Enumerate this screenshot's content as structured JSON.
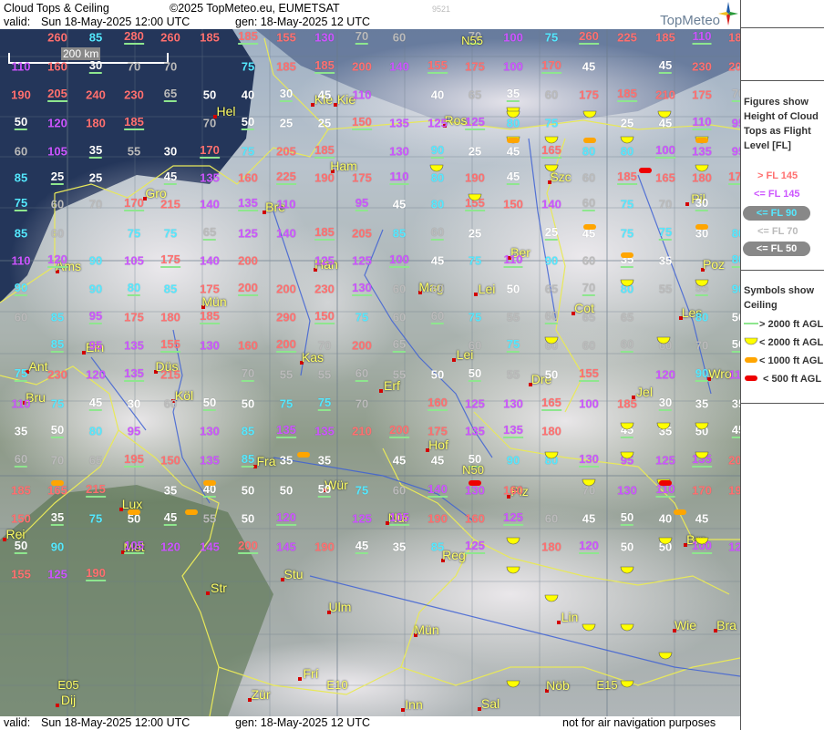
{
  "header": {
    "title": "Cloud Tops & Ceiling",
    "copyright": "©2025 TopMeteo.eu, EUMETSAT",
    "tiny_code": "9521",
    "valid_label": "valid:",
    "valid_value": "Sun  18-May-2025  12:00 UTC",
    "gen": "gen: 18-May-2025 12 UTC",
    "logo": "TopMeteo"
  },
  "footer": {
    "valid_label": "valid:",
    "valid_value": "Sun  18-May-2025  12:00 UTC",
    "gen": "gen: 18-May-2025 12 UTC",
    "disclaimer": "not for air navigation purposes"
  },
  "scale_bar": {
    "label": "200 km"
  },
  "legend": {
    "title": "Figures show Height of Cloud Tops as Flight Level  [FL]",
    "items": [
      {
        "label": "> FL 145",
        "color": "#ff7070"
      },
      {
        "label": "<= FL 145",
        "color": "#cc55ff"
      },
      {
        "label": "<= FL 90",
        "color": "#55e8ff"
      },
      {
        "label": "<= FL 70",
        "color": "#bbbbbb"
      },
      {
        "label": "<= FL 50",
        "color": "#ffffff"
      }
    ],
    "symbols_title": "Symbols show Ceiling",
    "symbols": [
      {
        "label": "> 2000 ft AGL",
        "icon": "green-line-icon"
      },
      {
        "label": "< 2000 ft AGL",
        "icon": "yellow-half-circle-icon"
      },
      {
        "label": "< 1000 ft AGL",
        "icon": "orange-oval-icon"
      },
      {
        "label": "< 500 ft AGL",
        "icon": "red-oval-icon"
      }
    ]
  },
  "colors": {
    "gt145": "#ff7070",
    "le145": "#cc55ff",
    "le90": "#55e8ff",
    "le70": "#bbbbbb",
    "le50": "#ffffff",
    "ceiling_high": "#8ee68e",
    "ceiling_2000": "#ffff00",
    "ceiling_1000": "#ffa500",
    "ceiling_500": "#ee0000"
  },
  "cities": [
    "Hel",
    "Kie",
    "Ham",
    "Ros",
    "Gro",
    "Bre",
    "Szc",
    "Pil",
    "Ams",
    "Han",
    "Ber",
    "Poz",
    "Mün",
    "Mag",
    "Lei",
    "Cot",
    "Les",
    "Ein",
    "Ant",
    "Düs",
    "Kas",
    "Erf",
    "Lei",
    "Dre",
    "Wro",
    "Bru",
    "Köl",
    "Jel",
    "Fra",
    "Hof",
    "Plz",
    "Brn",
    "Lux",
    "Wür",
    "Nür",
    "Rei",
    "Met",
    "Reg",
    "Str",
    "Stu",
    "Ulm",
    "Lin",
    "Wie",
    "Bra",
    "Mün",
    "Frí",
    "Zür",
    "Inn",
    "Sal",
    "Nöb",
    "Dij",
    "Kle"
  ],
  "grid_labels": [
    "N55",
    "N50",
    "E05",
    "E10",
    "E15"
  ],
  "cloud_top_values": [
    "260",
    "85",
    "280",
    "260",
    "185",
    "185",
    "155",
    "130",
    "70",
    "60",
    "70",
    "100",
    "75",
    "260",
    "225",
    "185",
    "110",
    "180",
    "110",
    "160",
    "30",
    "70",
    "70",
    "75",
    "185",
    "185",
    "200",
    "140",
    "155",
    "175",
    "100",
    "170",
    "45",
    "45",
    "230",
    "200",
    "190",
    "205",
    "240",
    "230",
    "65",
    "50",
    "40",
    "30",
    "45",
    "110",
    "40",
    "65",
    "35",
    "60",
    "175",
    "185",
    "210",
    "175",
    "70",
    "50",
    "120",
    "180",
    "185",
    "70",
    "50",
    "25",
    "25",
    "150",
    "135",
    "125",
    "125",
    "80",
    "75",
    "25",
    "45",
    "110",
    "95",
    "60",
    "105",
    "35",
    "55",
    "30",
    "170",
    "75",
    "205",
    "185",
    "130",
    "90",
    "25",
    "45",
    "165",
    "80",
    "80",
    "100",
    "135",
    "95",
    "85",
    "25",
    "25",
    "45",
    "135",
    "160",
    "225",
    "190",
    "175",
    "110",
    "80",
    "190",
    "45",
    "60",
    "185",
    "165",
    "180",
    "170",
    "75",
    "60",
    "70",
    "170",
    "215",
    "140",
    "135",
    "110",
    "95",
    "45",
    "80",
    "155",
    "150",
    "140",
    "60",
    "75",
    "70",
    "30",
    "85",
    "60",
    "75",
    "75",
    "65",
    "125",
    "140",
    "185",
    "205",
    "85",
    "60",
    "25",
    "25",
    "45",
    "75",
    "75",
    "30",
    "80",
    "110",
    "120",
    "90",
    "105",
    "175",
    "140",
    "200",
    "125",
    "125",
    "100",
    "45",
    "75",
    "110",
    "90",
    "60",
    "35",
    "35",
    "80",
    "90",
    "90",
    "80",
    "85",
    "175",
    "200",
    "200",
    "230",
    "130",
    "60",
    "60",
    "50",
    "65",
    "70",
    "80",
    "55",
    "55",
    "90",
    "60",
    "85",
    "95",
    "175",
    "180",
    "185",
    "290",
    "150",
    "75",
    "60",
    "60",
    "75",
    "55",
    "60",
    "65",
    "65",
    "80",
    "50",
    "85",
    "95",
    "135",
    "155",
    "130",
    "160",
    "200",
    "70",
    "200",
    "65",
    "60",
    "75",
    "60",
    "60",
    "60",
    "60",
    "70",
    "50",
    "75",
    "230",
    "120",
    "135",
    "215",
    "70",
    "55",
    "55",
    "60",
    "55",
    "50",
    "50",
    "55",
    "50",
    "155",
    "120",
    "90",
    "115",
    "110",
    "75",
    "45",
    "30",
    "60",
    "50",
    "50",
    "75",
    "75",
    "70",
    "160",
    "125",
    "130",
    "165",
    "100",
    "185",
    "30",
    "35",
    "35",
    "35",
    "50",
    "80",
    "95",
    "130",
    "85",
    "135",
    "135",
    "210",
    "200",
    "175",
    "135",
    "135",
    "180",
    "45",
    "35",
    "50",
    "45",
    "60",
    "70",
    "65",
    "195",
    "150",
    "135",
    "85",
    "35",
    "35",
    "45",
    "45",
    "50",
    "90",
    "80",
    "130",
    "95",
    "125",
    "135",
    "205",
    "185",
    "165",
    "215",
    "35",
    "40",
    "50",
    "50",
    "50",
    "75",
    "60",
    "140",
    "130",
    "160",
    "70",
    "130",
    "110",
    "170",
    "190",
    "150",
    "35",
    "75",
    "50",
    "45",
    "55",
    "50",
    "120",
    "125",
    "105",
    "190",
    "160",
    "125",
    "60",
    "45",
    "50",
    "40",
    "45",
    "50",
    "90",
    "105",
    "120",
    "145",
    "200",
    "145",
    "190",
    "45",
    "35",
    "85",
    "125",
    "180",
    "120",
    "50",
    "50",
    "100",
    "125",
    "155",
    "125",
    "190"
  ]
}
